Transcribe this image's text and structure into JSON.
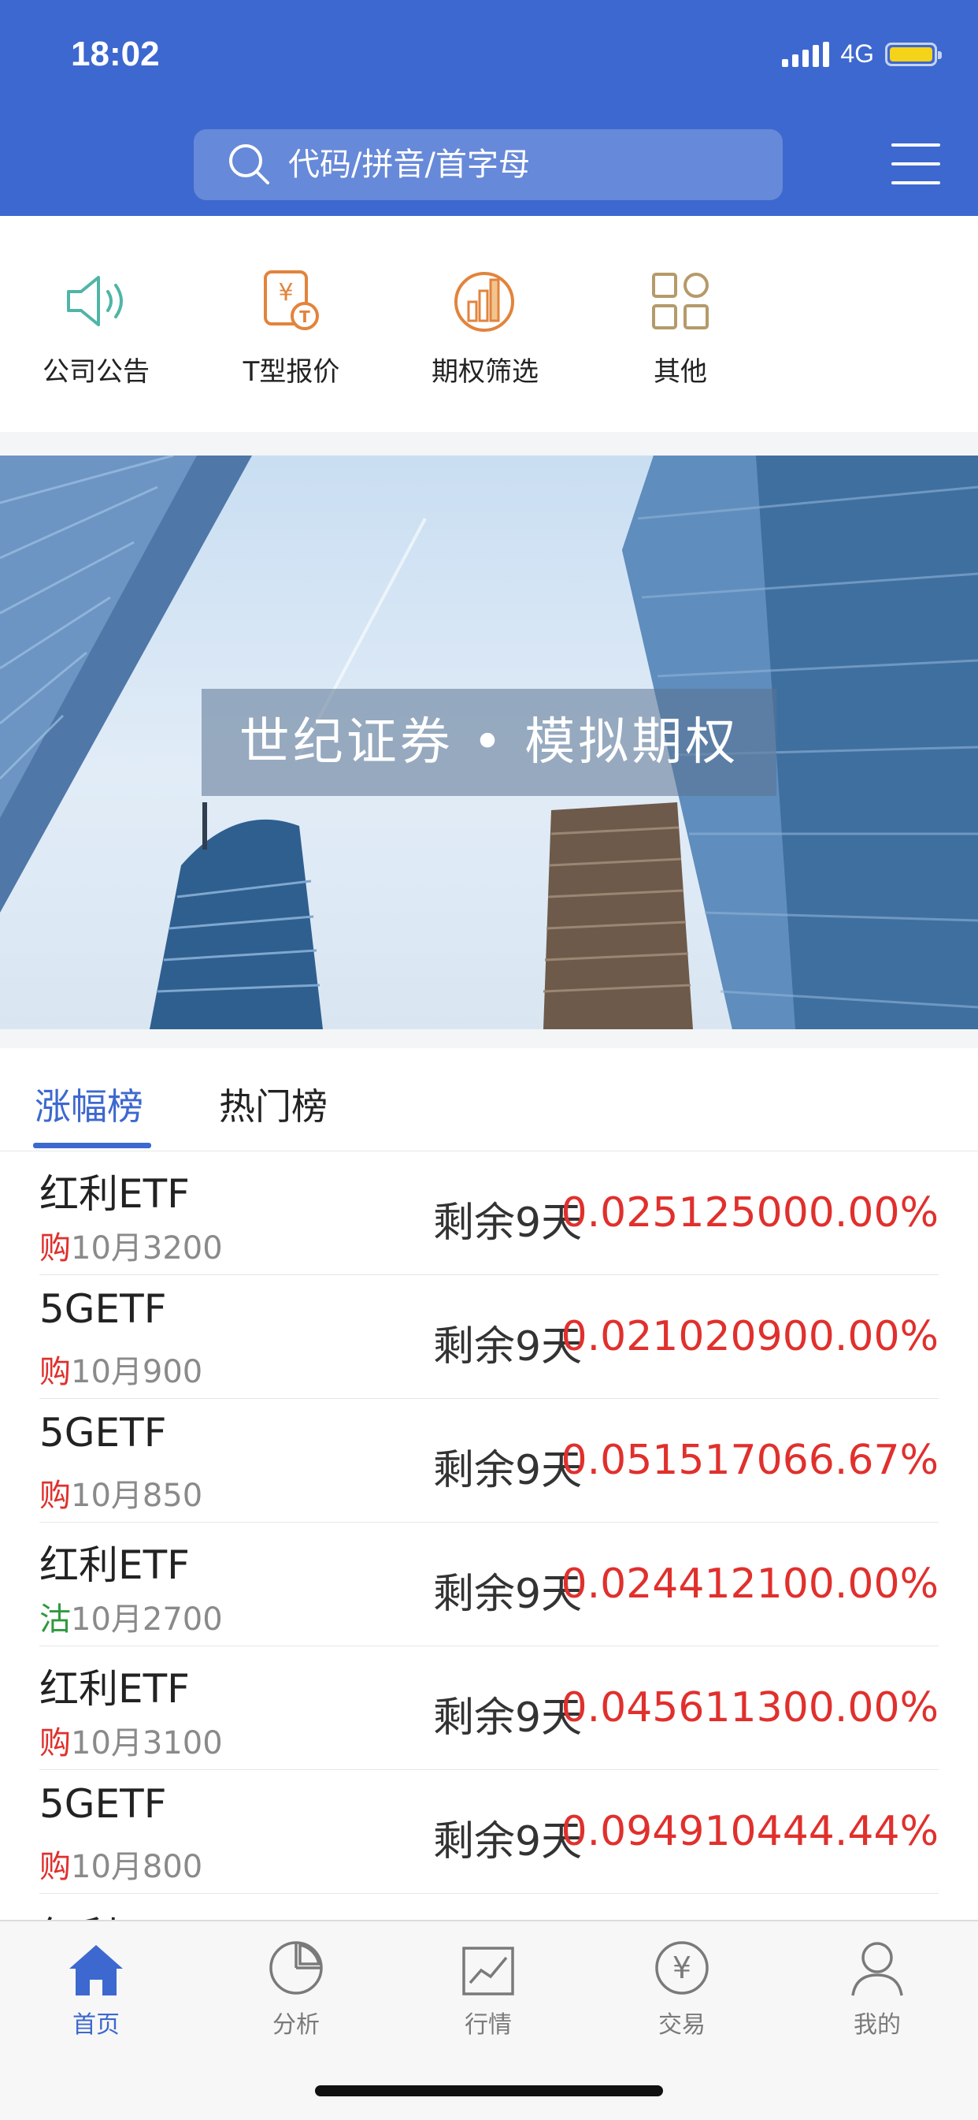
{
  "status": {
    "time": "18:02",
    "network": "4G"
  },
  "search": {
    "placeholder": "代码/拼音/首字母"
  },
  "quick_actions": [
    {
      "label": "公司公告",
      "icon": "speaker-icon"
    },
    {
      "label": "T型报价",
      "icon": "t-quote-icon"
    },
    {
      "label": "期权筛选",
      "icon": "filter-chart-icon"
    },
    {
      "label": "其他",
      "icon": "grid-apps-icon"
    }
  ],
  "banner": {
    "title": "世纪证券 • 模拟期权"
  },
  "tabs": [
    {
      "label": "涨幅榜",
      "active": true
    },
    {
      "label": "热门榜",
      "active": false
    }
  ],
  "list": [
    {
      "name": "红利ETF",
      "tag": "购",
      "tag_color": "#e0302d",
      "contract": "10月3200",
      "remain": "剩余9天",
      "pct": "0.025125000.00%"
    },
    {
      "name": "5GETF",
      "tag": "购",
      "tag_color": "#e0302d",
      "contract": "10月900",
      "remain": "剩余9天",
      "pct": "0.021020900.00%"
    },
    {
      "name": "5GETF",
      "tag": "购",
      "tag_color": "#e0302d",
      "contract": "10月850",
      "remain": "剩余9天",
      "pct": "0.051517066.67%"
    },
    {
      "name": "红利ETF",
      "tag": "沽",
      "tag_color": "#2e9a3f",
      "contract": "10月2700",
      "remain": "剩余9天",
      "pct": "0.024412100.00%"
    },
    {
      "name": "红利ETF",
      "tag": "购",
      "tag_color": "#e0302d",
      "contract": "10月3100",
      "remain": "剩余9天",
      "pct": "0.045611300.00%"
    },
    {
      "name": "5GETF",
      "tag": "购",
      "tag_color": "#e0302d",
      "contract": "10月800",
      "remain": "剩余9天",
      "pct": "0.094910444.44%"
    },
    {
      "name": "红利ETF",
      "tag": "",
      "tag_color": "#e0302d",
      "contract": "",
      "remain": "",
      "pct": ""
    }
  ],
  "tabbar": [
    {
      "label": "首页",
      "icon": "home-icon",
      "active": true
    },
    {
      "label": "分析",
      "icon": "pie-chart-icon",
      "active": false
    },
    {
      "label": "行情",
      "icon": "line-chart-icon",
      "active": false
    },
    {
      "label": "交易",
      "icon": "yuan-coin-icon",
      "active": false
    },
    {
      "label": "我的",
      "icon": "user-icon",
      "active": false
    }
  ],
  "colors": {
    "brand": "#3d68cf",
    "rise": "#e0302d",
    "fall": "#2e9a3f"
  }
}
